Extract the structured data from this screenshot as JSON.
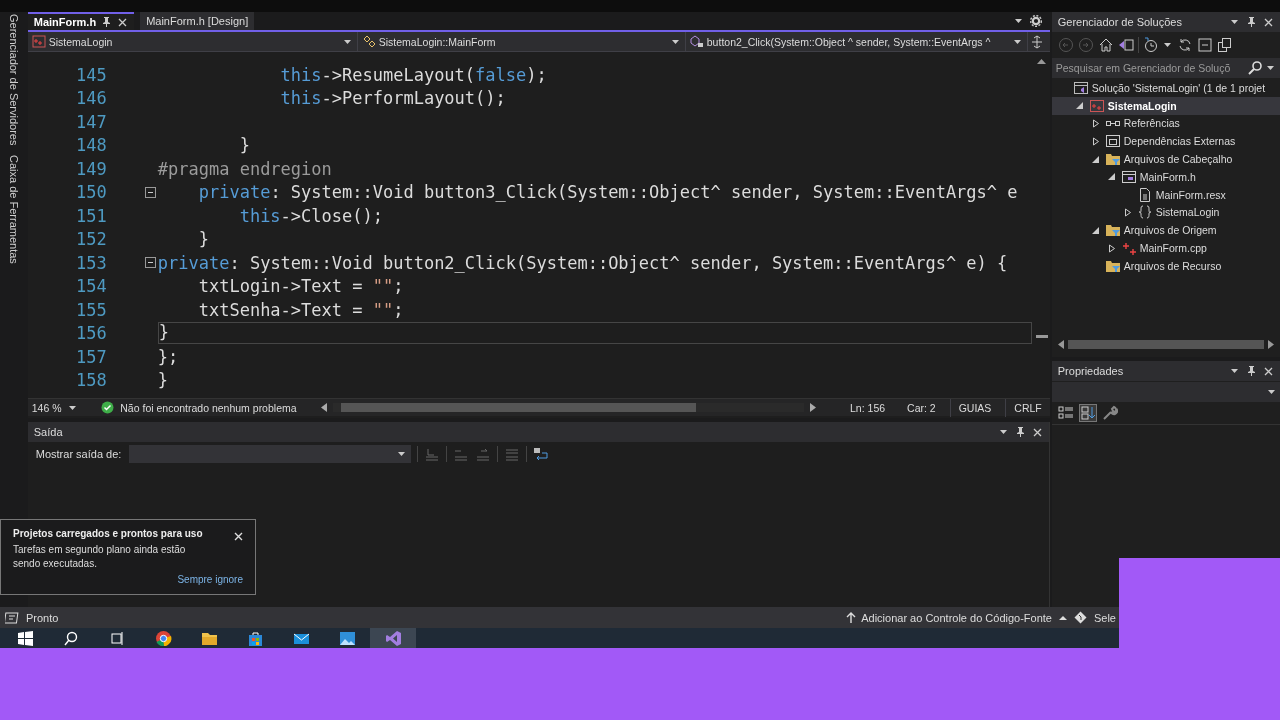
{
  "left_rail": {
    "tabs": [
      {
        "label": "Gerenciador de Servidores"
      },
      {
        "label": "Caixa de Ferramentas"
      }
    ]
  },
  "editor": {
    "tabs": [
      {
        "label": "MainForm.h",
        "selected": true
      },
      {
        "label": "MainForm.h [Design]",
        "selected": false
      }
    ],
    "nav": {
      "project": "SistemaLogin",
      "type": "SistemaLogin::MainForm",
      "member": "button2_Click(System::Object ^ sender, System::EventArgs ^"
    },
    "lines": [
      {
        "number": "145",
        "current": false,
        "tokens": [
          {
            "text": "            this",
            "kind": "keyword"
          },
          {
            "text": "->ResumeLayout(",
            "kind": "plain"
          },
          {
            "text": "false",
            "kind": "keyword"
          },
          {
            "text": ");",
            "kind": "plain"
          }
        ]
      },
      {
        "number": "146",
        "current": false,
        "tokens": [
          {
            "text": "            this",
            "kind": "keyword"
          },
          {
            "text": "->PerformLayout();",
            "kind": "plain"
          }
        ]
      },
      {
        "number": "147",
        "current": false
      },
      {
        "number": "148",
        "current": false,
        "tokens": [
          {
            "text": "        }",
            "kind": "plain"
          }
        ]
      },
      {
        "number": "149",
        "current": false,
        "tokens": [
          {
            "text": "#pragma endregion",
            "kind": "preprocessor"
          }
        ]
      },
      {
        "number": "150",
        "current": false,
        "fold": {
          "expanded": true
        },
        "tokens": [
          {
            "text": "    private",
            "kind": "keyword"
          },
          {
            "text": ": System::Void button3_Click(System::Object^ sender, System::EventArgs^ e",
            "kind": "plain"
          }
        ]
      },
      {
        "number": "151",
        "current": false,
        "tokens": [
          {
            "text": "        this",
            "kind": "keyword"
          },
          {
            "text": "->Close();",
            "kind": "plain"
          }
        ]
      },
      {
        "number": "152",
        "current": false,
        "tokens": [
          {
            "text": "    }",
            "kind": "plain"
          }
        ]
      },
      {
        "number": "153",
        "current": false,
        "fold": {
          "expanded": true
        },
        "tokens": [
          {
            "text": "private",
            "kind": "keyword"
          },
          {
            "text": ": System::Void button2_Click(System::Object^ sender, System::EventArgs^ e) {",
            "kind": "plain"
          }
        ]
      },
      {
        "number": "154",
        "current": false,
        "tokens": [
          {
            "text": "    txtLogin->Text = ",
            "kind": "plain"
          },
          {
            "text": "\"\"",
            "kind": "string"
          },
          {
            "text": ";",
            "kind": "plain"
          }
        ]
      },
      {
        "number": "155",
        "current": false,
        "tokens": [
          {
            "text": "    txtSenha->Text = ",
            "kind": "plain"
          },
          {
            "text": "\"\"",
            "kind": "string"
          },
          {
            "text": ";",
            "kind": "plain"
          }
        ]
      },
      {
        "number": "156",
        "current": true,
        "tokens": [
          {
            "text": "}",
            "kind": "plain"
          }
        ]
      },
      {
        "number": "157",
        "current": false,
        "tokens": [
          {
            "text": "};",
            "kind": "plain"
          }
        ]
      },
      {
        "number": "158",
        "current": false,
        "tokens": [
          {
            "text": "}",
            "kind": "plain"
          }
        ]
      }
    ],
    "status": {
      "zoom": "146 %",
      "issues": "Não foi encontrado nenhum problema",
      "line": "Ln: 156",
      "column": "Car: 2",
      "indent": "GUIAS",
      "line_ending": "CRLF"
    }
  },
  "output": {
    "title": "Saída",
    "show_from_label": "Mostrar saída de:"
  },
  "notification": {
    "title": "Projetos carregados e prontos para uso",
    "message": "Tarefas em segundo plano ainda estão sendo executadas.",
    "link": "Sempre ignore"
  },
  "solution_explorer": {
    "title": "Gerenciador de Soluções",
    "search": {
      "placeholder": "Pesquisar em Gerenciador de Soluçõ"
    },
    "tree": [
      {
        "label": "Solução 'SistemaLogin' (1 de 1 projet",
        "kind": "solution",
        "selected": false,
        "children": [
          {
            "label": "SistemaLogin",
            "kind": "project",
            "selected": true,
            "expanded": true,
            "children": [
              {
                "label": "Referências",
                "kind": "references",
                "selected": false,
                "expanded": false
              },
              {
                "label": "Dependências Externas",
                "kind": "external",
                "selected": false,
                "expanded": false
              },
              {
                "label": "Arquivos de Cabeçalho",
                "kind": "filter",
                "selected": false,
                "expanded": true,
                "children": [
                  {
                    "label": "MainForm.h",
                    "kind": "form",
                    "selected": false,
                    "expanded": true,
                    "children": [
                      {
                        "label": "MainForm.resx",
                        "kind": "resource",
                        "selected": false
                      },
                      {
                        "label": "SistemaLogin",
                        "kind": "namespace",
                        "selected": false,
                        "expanded": false
                      }
                    ]
                  }
                ]
              },
              {
                "label": "Arquivos de Origem",
                "kind": "filter",
                "selected": false,
                "expanded": true,
                "children": [
                  {
                    "label": "MainForm.cpp",
                    "kind": "cpp",
                    "selected": false,
                    "expanded": false
                  }
                ]
              },
              {
                "label": "Arquivos de Recurso",
                "kind": "filter",
                "selected": false
              }
            ]
          }
        ]
      }
    ]
  },
  "properties": {
    "title": "Propriedades"
  },
  "status_bar": {
    "message": "Pronto",
    "source_control": "Adicionar ao Controle do Código-Fonte",
    "repository": "Sele"
  },
  "taskbar": {
    "apps": [
      {
        "kind": "start",
        "selected": false
      },
      {
        "kind": "search",
        "selected": false
      },
      {
        "kind": "taskview",
        "selected": false
      },
      {
        "kind": "browser",
        "selected": false
      },
      {
        "kind": "folder",
        "selected": false
      },
      {
        "kind": "store",
        "selected": false
      },
      {
        "kind": "mail",
        "selected": false
      },
      {
        "kind": "photos",
        "selected": false
      },
      {
        "kind": "ide",
        "selected": true
      }
    ]
  }
}
